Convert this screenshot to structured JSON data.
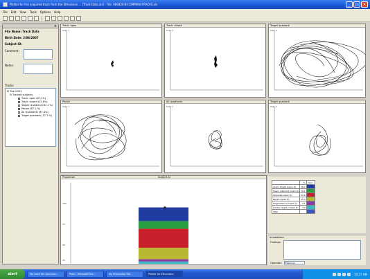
{
  "window": {
    "title": "Plotter for the acquired track from the Ethovision ... [Track Data.xls] - File: 060420-B-COMPARE-TRACKS.xls"
  },
  "menu": [
    "File",
    "Edit",
    "View",
    "Tools",
    "Options",
    "Help"
  ],
  "left_panel": {
    "fields": [
      {
        "label": "File Name:",
        "value": "Track Data"
      },
      {
        "label": "Birth Date:",
        "value": "2/06/2007"
      },
      {
        "label": "Subject ID:",
        "value": ""
      }
    ],
    "inputs": [
      {
        "label": "Comment:"
      },
      {
        "label": "Notes:"
      }
    ],
    "tree_header": "Tracks",
    "tree_root": "Trial 0001",
    "tree_group": "Tracked subjects",
    "tree_items": [
      "Track: open (87.4%)",
      "Track: closed (12.6%)",
      "Target: quadrant (87.1 %)",
      "Periph (87.1 %)",
      "All Quadrants (87.4%)",
      "Target quadrant (12.1 %)"
    ]
  },
  "plots": [
    {
      "title": "Track: open",
      "tag": "Subj: 1"
    },
    {
      "title": "Track: closed",
      "tag": "Subj: 1"
    },
    {
      "title": "Target quadrant",
      "tag": "Subj: 1"
    },
    {
      "title": "Periph",
      "tag": "Subj: 1"
    },
    {
      "title": "All quadrants",
      "tag": "Subj: 1"
    },
    {
      "title": "Target quadrant",
      "tag": "Subj: 1"
    }
  ],
  "bar_panel": {
    "title": "Proportion",
    "caption": "Subject ID",
    "yticks": [
      "100",
      "75",
      "50",
      "25",
      "0"
    ],
    "segments": [
      {
        "name": "Cyan",
        "value": 3,
        "color": "#38b8c8"
      },
      {
        "name": "Purple",
        "value": 3,
        "color": "#8a3aa0"
      },
      {
        "name": "Olive",
        "value": 15,
        "color": "#b8b830"
      },
      {
        "name": "Red",
        "value": 25,
        "color": "#c8202a"
      },
      {
        "name": "Green",
        "value": 10,
        "color": "#28a040"
      },
      {
        "name": "Blue",
        "value": 18,
        "color": "#203ca0"
      }
    ],
    "total_label": "■"
  },
  "legend": {
    "header": [
      "",
      "%",
      "Color"
    ],
    "rows": [
      {
        "name": "Quad. target (open Q)",
        "value": "18.2",
        "color": "#203ca0"
      },
      {
        "name": "Quad. adjacent (open Q)",
        "value": "10.1",
        "color": "#28a040"
      },
      {
        "name": "Opposite (open Q)",
        "value": "24.6",
        "color": "#c8202a"
      },
      {
        "name": "Periph (open Q)",
        "value": "15.3",
        "color": "#b8b830"
      },
      {
        "name": "Thigmotaxis (closed Q)",
        "value": "3.1",
        "color": "#8a3aa0"
      },
      {
        "name": "Center target (closed Q)",
        "value": "3.2",
        "color": "#38b8c8"
      },
      {
        "name": "Total",
        "value": "",
        "color": "#3a58c8"
      }
    ]
  },
  "notes_panel": {
    "header": "Annotations",
    "label": "Findings:",
    "operator_label": "Operator:",
    "operator_value": "Examiner"
  },
  "taskbar": {
    "start": "start",
    "tasks": [
      "My track file (Accurac...",
      "Plots - Microsoft Exc...",
      "My Ethovision file...",
      "Plotter for Ethovision"
    ],
    "clock": "10:27 AM"
  }
}
